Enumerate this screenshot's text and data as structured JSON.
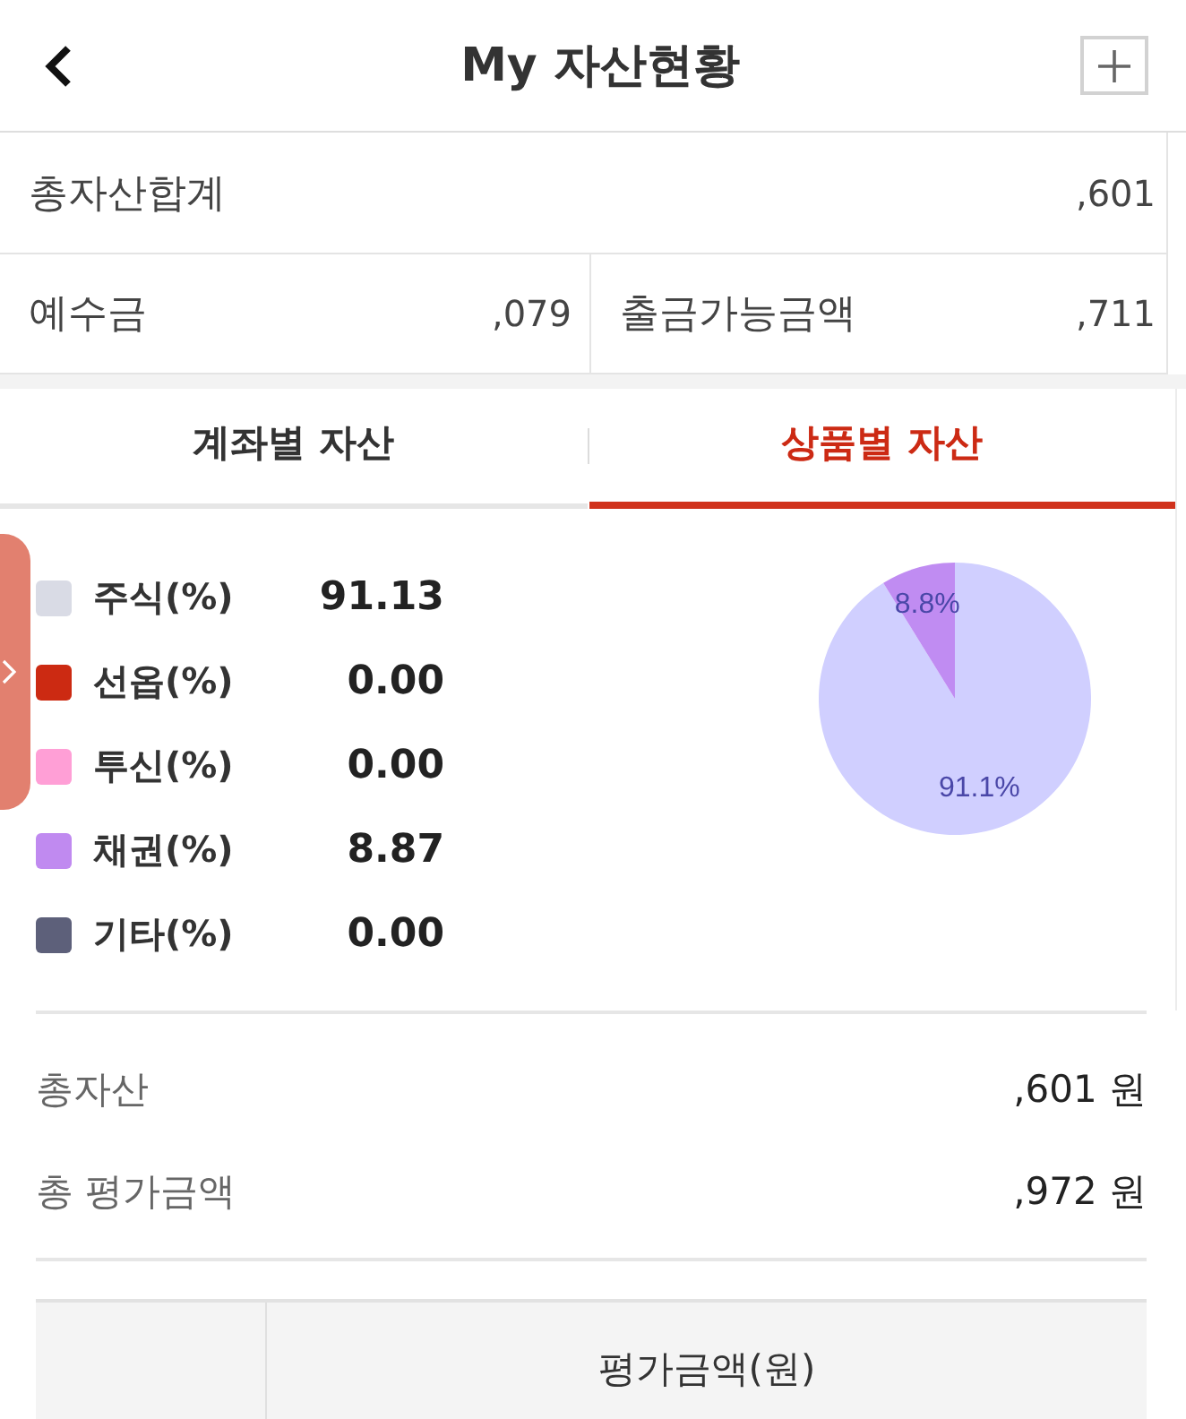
{
  "header": {
    "title": "My 자산현황"
  },
  "summary": {
    "total": {
      "label": "총자산합계",
      "value": ",601"
    },
    "cells": [
      {
        "label": "예수금",
        "value": ",079"
      },
      {
        "label": "출금가능금액",
        "value": ",711"
      }
    ]
  },
  "tabs": [
    {
      "label": "계좌별 자산",
      "selected": false
    },
    {
      "label": "상품별 자산",
      "selected": true
    }
  ],
  "allocation": {
    "items": [
      {
        "label": "주식(%)",
        "value": "91.13",
        "color": "#d9dbe5"
      },
      {
        "label": "선옵(%)",
        "value": "0.00",
        "color": "#cc2a12"
      },
      {
        "label": "투신(%)",
        "value": "0.00",
        "color": "#ff9fd6"
      },
      {
        "label": "채권(%)",
        "value": "8.87",
        "color": "#c08af0"
      },
      {
        "label": "기타(%)",
        "value": "0.00",
        "color": "#5d607a"
      }
    ],
    "chart_data": {
      "type": "pie",
      "values": [
        91.1,
        8.8
      ],
      "colors": [
        "#d0cfff",
        "#c08cf2"
      ],
      "value_labels": [
        "91.1%",
        "8.8%"
      ]
    }
  },
  "totals": [
    {
      "label": "총자산",
      "value": ",601 원"
    },
    {
      "label": "총 평가금액",
      "value": ",972 원"
    }
  ],
  "table": {
    "columns": [
      "평가금액(원)"
    ]
  }
}
